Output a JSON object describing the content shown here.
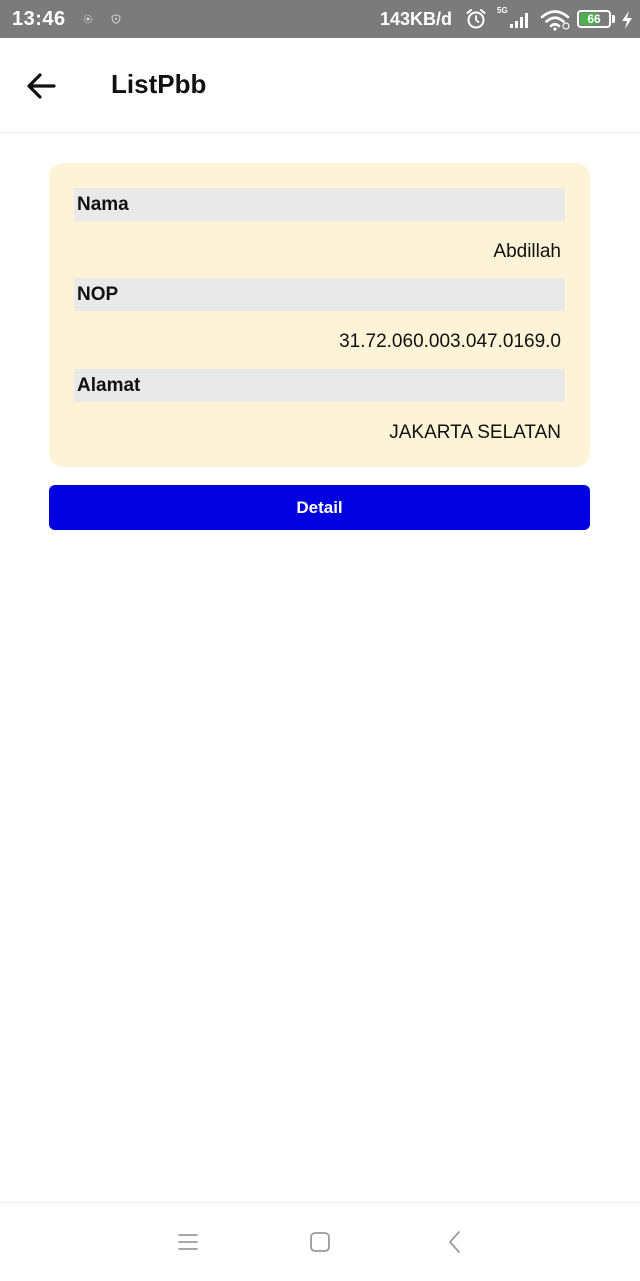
{
  "status_bar": {
    "time": "13:46",
    "network_speed": "143KB/d",
    "network_type": "5G",
    "battery_level": "66",
    "battery_fraction": 0.66,
    "icons": [
      "cast-icon",
      "shield-icon",
      "alarm-icon",
      "signal-icon",
      "wifi-icon",
      "battery-icon",
      "charging-icon"
    ]
  },
  "app_bar": {
    "title": "ListPbb",
    "back_icon": "arrow-left-icon"
  },
  "card": {
    "fields": [
      {
        "label": "Nama",
        "value": "Abdillah"
      },
      {
        "label": "NOP",
        "value": "31.72.060.003.047.0169.0"
      },
      {
        "label": "Alamat",
        "value": "JAKARTA SELATAN"
      }
    ]
  },
  "actions": {
    "detail_label": "Detail"
  },
  "nav_bar": {
    "icons": [
      "menu-icon",
      "home-icon",
      "back-icon"
    ]
  },
  "colors": {
    "status_bar_bg": "#7b7b7b",
    "card_bg": "#fdf3d6",
    "label_bar_bg": "#e9e9e9",
    "primary_button": "#0000e0",
    "battery_fill": "#4caf50"
  }
}
